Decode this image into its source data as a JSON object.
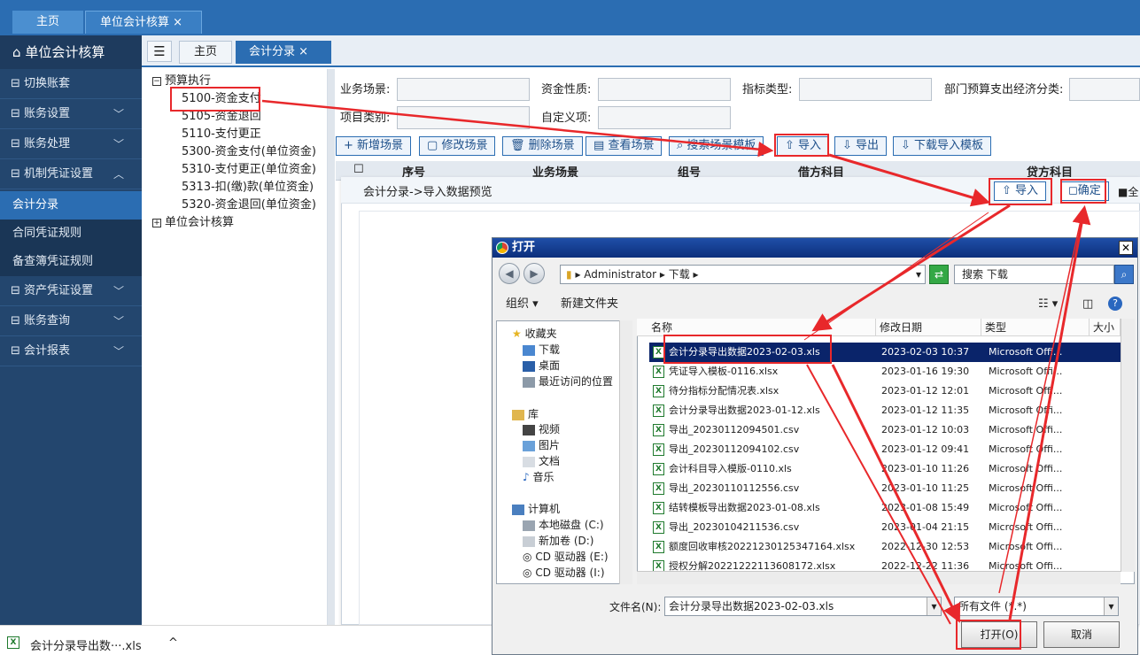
{
  "top_tabs": {
    "home": "主页",
    "unit": "单位会计核算",
    "close": "×"
  },
  "sidebar": {
    "title": "单位会计核算",
    "items": [
      {
        "label": "切换账套"
      },
      {
        "label": "账务设置"
      },
      {
        "label": "账务处理"
      },
      {
        "label": "机制凭证设置"
      },
      {
        "label": "资产凭证设置"
      },
      {
        "label": "账务查询"
      },
      {
        "label": "会计报表"
      }
    ],
    "subitems": [
      {
        "label": "会计分录"
      },
      {
        "label": "合同凭证规则"
      },
      {
        "label": "备查簿凭证规则"
      }
    ]
  },
  "content_tabs": {
    "menu": "☰",
    "home": "主页",
    "current": "会计分录",
    "close": "×"
  },
  "tree": {
    "root1": "预算执行",
    "children": [
      "5100-资金支付",
      "5105-资金退回",
      "5110-支付更正",
      "5300-资金支付(单位资金)",
      "5310-支付更正(单位资金)",
      "5313-扣(缴)款(单位资金)",
      "5320-资金退回(单位资金)"
    ],
    "root2": "单位会计核算",
    "expand": "−",
    "collapse": "+"
  },
  "filters": {
    "scene": "业务场景:",
    "fund": "资金性质:",
    "indicator": "指标类型:",
    "dept": "部门预算支出经济分类:",
    "project": "项目类别:",
    "custom": "自定义项:"
  },
  "toolbar": {
    "add": "+ 新增场景",
    "edit": "修改场景",
    "delete": "删除场景",
    "view": "查看场景",
    "search": "搜索场景模板",
    "import": "导入",
    "export": "导出",
    "download": "下载导入模板"
  },
  "grid_headers": {
    "no": "序号",
    "scene": "业务场景",
    "group": "组号",
    "debit": "借方科目",
    "credit": "贷方科目"
  },
  "preview": {
    "title": "会计分录->导入数据预览",
    "import": "导入",
    "confirm": "确定",
    "all": "全"
  },
  "file_dialog": {
    "title": "打开",
    "address": "▸ Administrator ▸ 下载 ▸",
    "search_placeholder": "搜索 下载",
    "organize": "组织 ▾",
    "new_folder": "新建文件夹",
    "nav": {
      "favorites": "收藏夹",
      "downloads": "下载",
      "desktop": "桌面",
      "recent": "最近访问的位置",
      "libraries": "库",
      "video": "视频",
      "pictures": "图片",
      "docs": "文档",
      "music": "音乐",
      "computer": "计算机",
      "disk_c": "本地磁盘 (C:)",
      "vol_d": "新加卷 (D:)",
      "cd_e": "CD 驱动器 (E:)",
      "cd_i": "CD 驱动器 (I:)"
    },
    "columns": {
      "name": "名称",
      "date": "修改日期",
      "type": "类型",
      "size": "大小"
    },
    "files": [
      {
        "name": "会计分录导出数据2023-02-03.xls",
        "date": "2023-02-03 10:37",
        "type": "Microsoft Offi...",
        "selected": true
      },
      {
        "name": "凭证导入模板-0116.xlsx",
        "date": "2023-01-16 19:30",
        "type": "Microsoft Offi..."
      },
      {
        "name": "待分指标分配情况表.xlsx",
        "date": "2023-01-12 12:01",
        "type": "Microsoft Offi..."
      },
      {
        "name": "会计分录导出数据2023-01-12.xls",
        "date": "2023-01-12 11:35",
        "type": "Microsoft Offi..."
      },
      {
        "name": "导出_20230112094501.csv",
        "date": "2023-01-12 10:03",
        "type": "Microsoft Offi..."
      },
      {
        "name": "导出_20230112094102.csv",
        "date": "2023-01-12 09:41",
        "type": "Microsoft Offi..."
      },
      {
        "name": "会计科目导入模版-0110.xls",
        "date": "2023-01-10 11:26",
        "type": "Microsoft Offi..."
      },
      {
        "name": "导出_20230110112556.csv",
        "date": "2023-01-10 11:25",
        "type": "Microsoft Offi..."
      },
      {
        "name": "结转模板导出数据2023-01-08.xls",
        "date": "2023-01-08 15:49",
        "type": "Microsoft Offi..."
      },
      {
        "name": "导出_20230104211536.csv",
        "date": "2023-01-04 21:15",
        "type": "Microsoft Offi..."
      },
      {
        "name": "额度回收审核20221230125347164.xlsx",
        "date": "2022-12-30 12:53",
        "type": "Microsoft Offi..."
      },
      {
        "name": "授权分解20221222113608172.xlsx",
        "date": "2022-12-22 11:36",
        "type": "Microsoft Offi..."
      }
    ],
    "filename_label": "文件名(N):",
    "filename_value": "会计分录导出数据2023-02-03.xls",
    "filetype": "所有文件 (*.*)",
    "open": "打开(O)",
    "cancel": "取消"
  },
  "download_bar": {
    "filename": "会计分录导出数···.xls",
    "chevron": "^"
  }
}
